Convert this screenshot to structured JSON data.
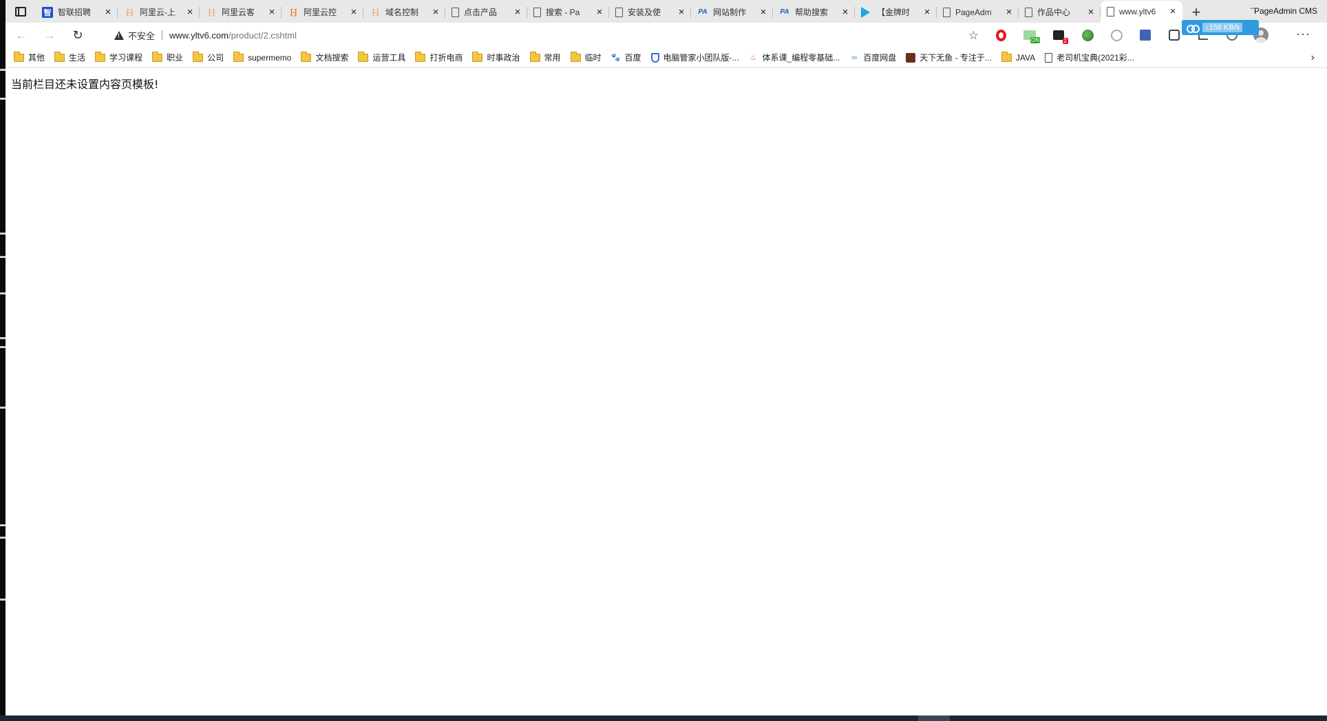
{
  "window": {
    "title": "PageAdmin CMS",
    "minimize_glyph": "—"
  },
  "tabs": [
    {
      "title": "智联招聘",
      "icon": "zhilian-icon"
    },
    {
      "title": "阿里云-上",
      "icon": "aliyun-icon"
    },
    {
      "title": "阿里云客",
      "icon": "aliyun-icon"
    },
    {
      "title": "阿里云控",
      "icon": "aliyun-icon"
    },
    {
      "title": "域名控制",
      "icon": "aliyun-icon"
    },
    {
      "title": "点击产品",
      "icon": "page-icon"
    },
    {
      "title": "搜索 - Pa",
      "icon": "page-icon"
    },
    {
      "title": "安装及使",
      "icon": "page-icon"
    },
    {
      "title": "网站制作",
      "icon": "pageadmin-icon"
    },
    {
      "title": "帮助搜索",
      "icon": "pageadmin-icon"
    },
    {
      "title": "【金牌时",
      "icon": "play-icon"
    },
    {
      "title": "PageAdm",
      "icon": "page-icon"
    },
    {
      "title": "作品中心",
      "icon": "page-icon"
    },
    {
      "title": "www.yltv6",
      "icon": "page-icon",
      "active": true
    }
  ],
  "tab_close_glyph": "×",
  "new_tab_glyph": "+",
  "download_widget": {
    "speed": "↓158 KB/s"
  },
  "toolbar": {
    "back_glyph": "←",
    "forward_glyph": "→",
    "reload_glyph": "↻",
    "security_label": "不安全",
    "url_host": "www.yltv6.com",
    "url_path": "/product/2.cshtml",
    "favorite_glyph": "☆",
    "menu_glyph": "···"
  },
  "bookmarks": [
    {
      "label": "其他",
      "icon": "folder-icon"
    },
    {
      "label": "生活",
      "icon": "folder-icon"
    },
    {
      "label": "学习课程",
      "icon": "folder-icon"
    },
    {
      "label": "职业",
      "icon": "folder-icon"
    },
    {
      "label": "公司",
      "icon": "folder-icon"
    },
    {
      "label": "supermemo",
      "icon": "folder-icon"
    },
    {
      "label": "文档搜索",
      "icon": "folder-icon"
    },
    {
      "label": "运营工具",
      "icon": "folder-icon"
    },
    {
      "label": "打折电商",
      "icon": "folder-icon"
    },
    {
      "label": "时事政治",
      "icon": "folder-icon"
    },
    {
      "label": "常用",
      "icon": "folder-icon"
    },
    {
      "label": "临时",
      "icon": "folder-icon"
    },
    {
      "label": "百度",
      "icon": "baidu-icon"
    },
    {
      "label": "电脑管家小团队版-...",
      "icon": "shield-icon"
    },
    {
      "label": "体系课_编程零基础...",
      "icon": "fire-icon"
    },
    {
      "label": "百度网盘",
      "icon": "cloud-icon"
    },
    {
      "label": "天下无鱼 - 专注于...",
      "icon": "fish-icon"
    },
    {
      "label": "JAVA",
      "icon": "folder-icon"
    },
    {
      "label": "老司机宝典(2021彩...",
      "icon": "page-icon"
    }
  ],
  "bookmarks_more_glyph": "›",
  "extensions": {
    "on_badge": "ON",
    "dark_badge": "2"
  },
  "content": {
    "message": "当前栏目还未设置内容页模板!"
  }
}
